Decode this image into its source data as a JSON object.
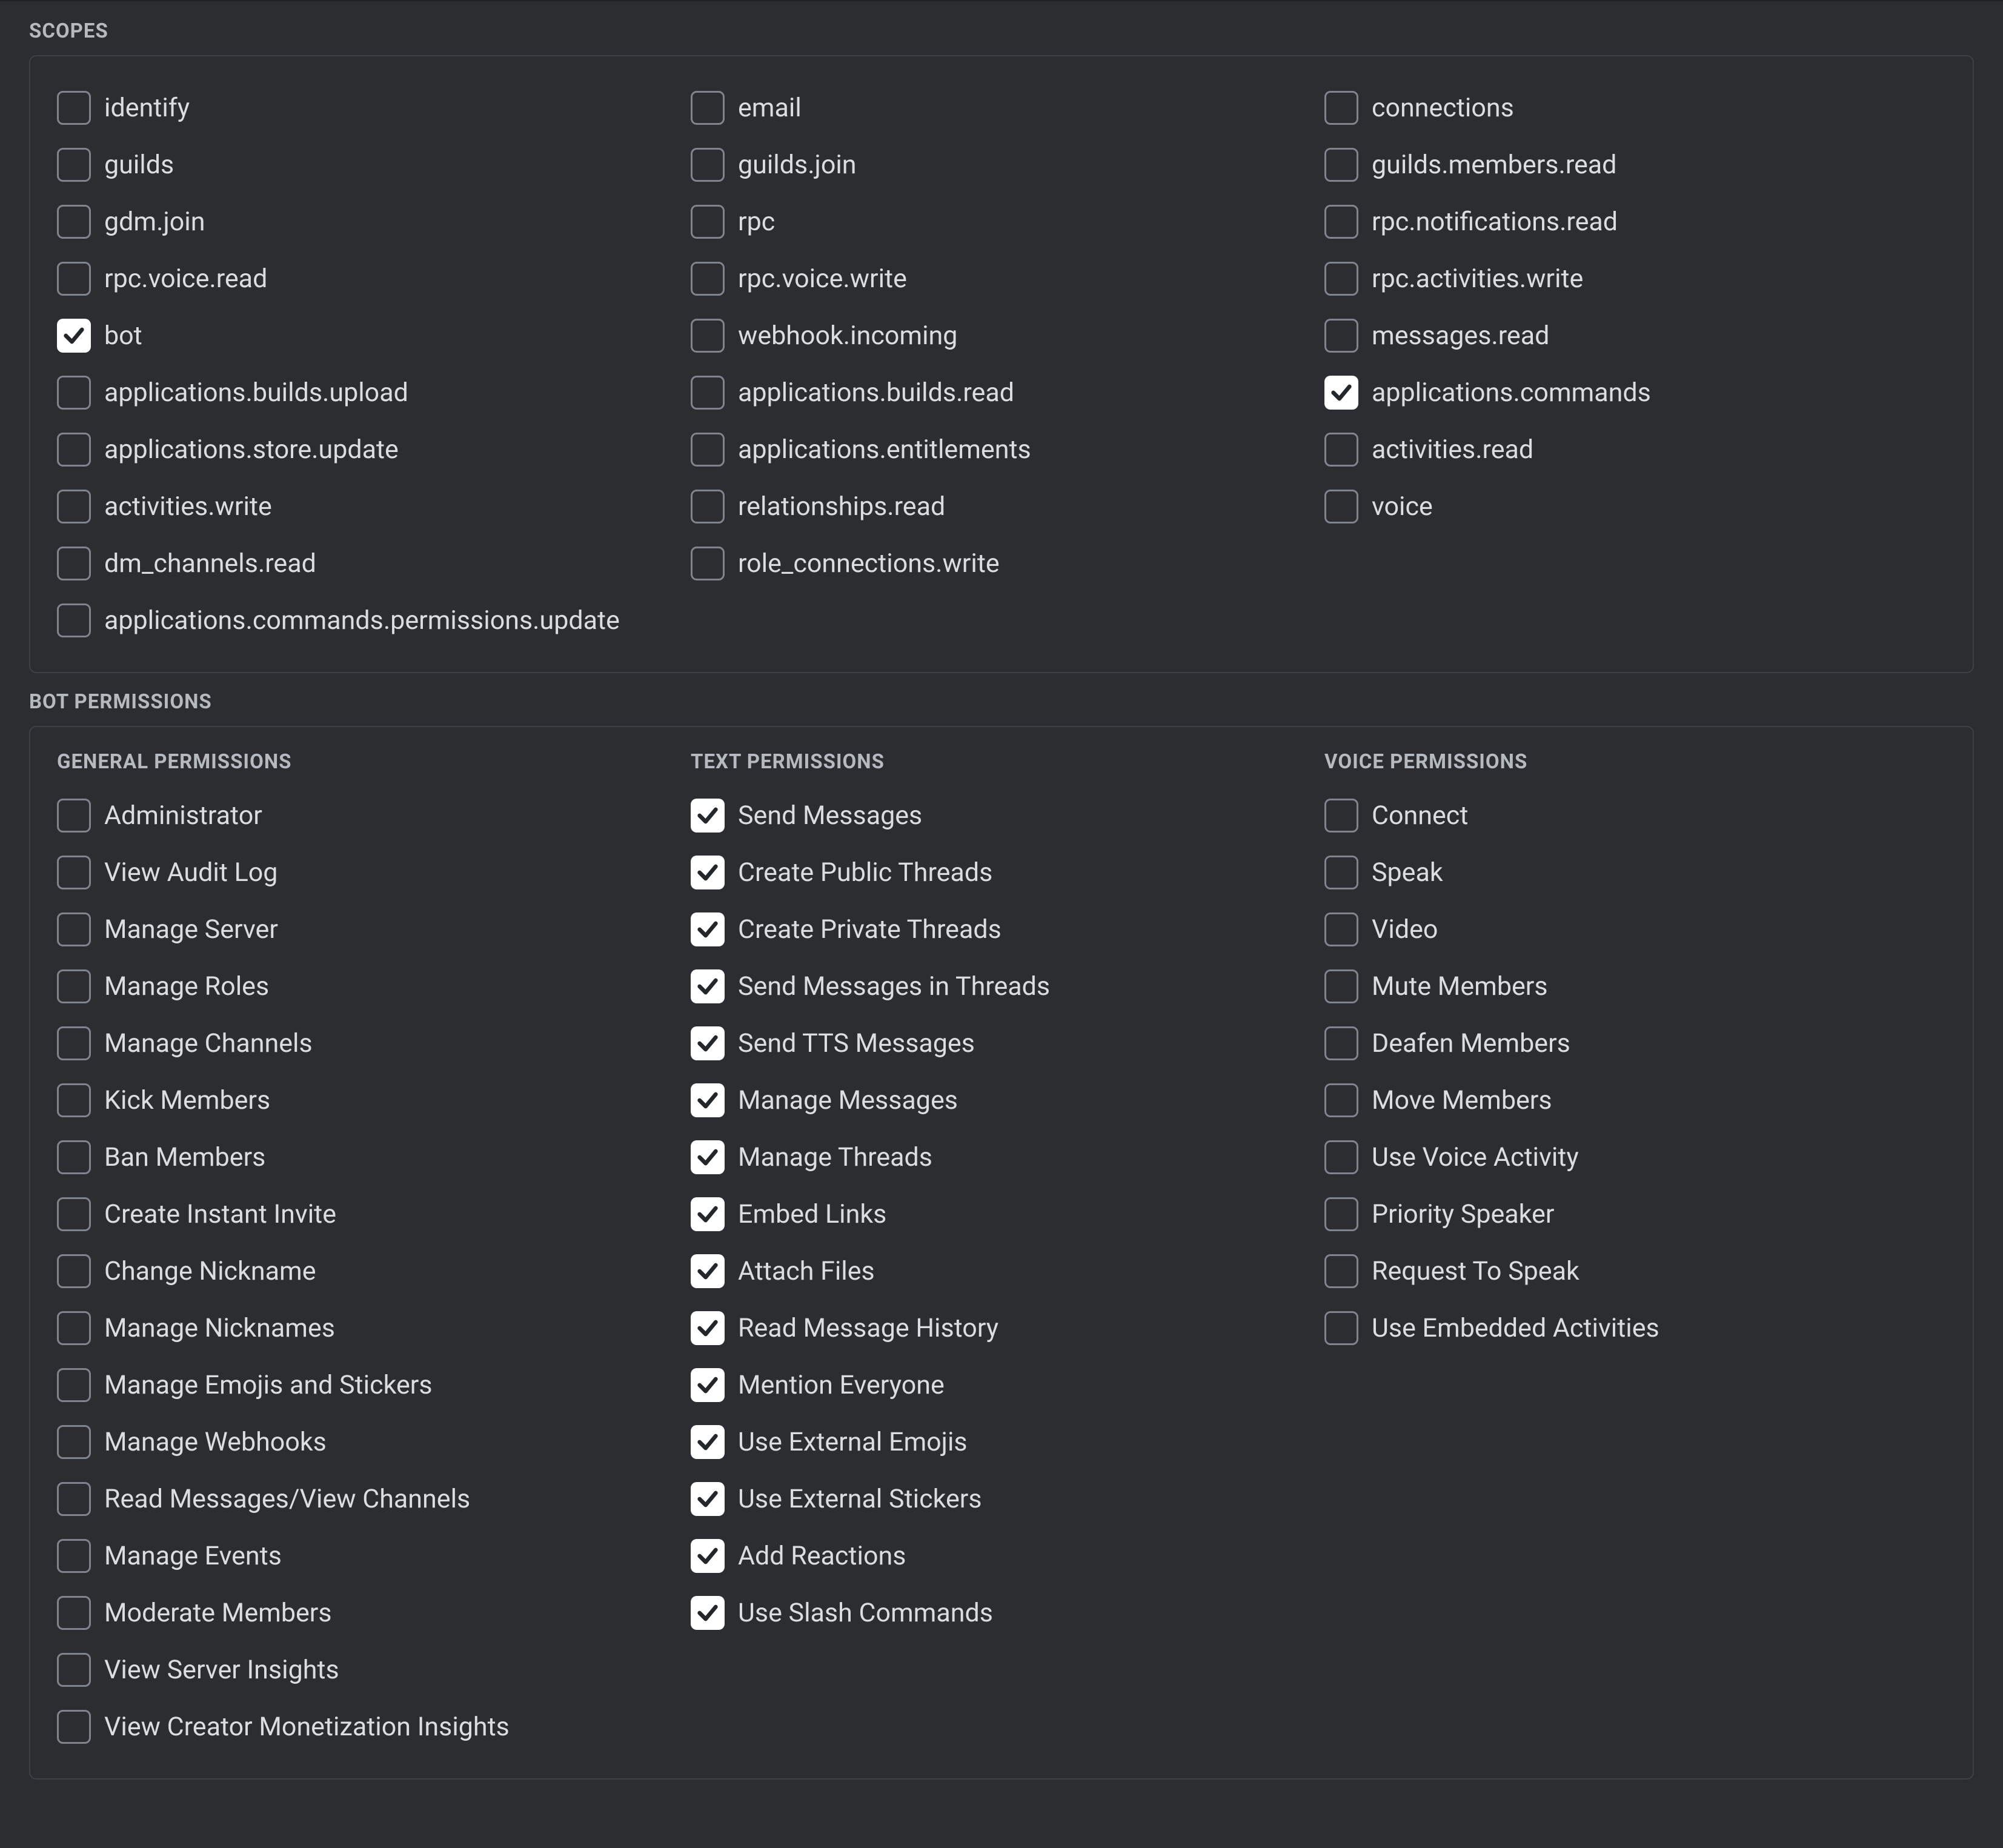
{
  "scopes": {
    "title": "SCOPES",
    "cols": [
      [
        {
          "label": "identify",
          "checked": false
        },
        {
          "label": "guilds",
          "checked": false
        },
        {
          "label": "gdm.join",
          "checked": false
        },
        {
          "label": "rpc.voice.read",
          "checked": false
        },
        {
          "label": "bot",
          "checked": true
        },
        {
          "label": "applications.builds.upload",
          "checked": false
        },
        {
          "label": "applications.store.update",
          "checked": false
        },
        {
          "label": "activities.write",
          "checked": false
        },
        {
          "label": "dm_channels.read",
          "checked": false
        },
        {
          "label": "applications.commands.permissions.update",
          "checked": false
        }
      ],
      [
        {
          "label": "email",
          "checked": false
        },
        {
          "label": "guilds.join",
          "checked": false
        },
        {
          "label": "rpc",
          "checked": false
        },
        {
          "label": "rpc.voice.write",
          "checked": false
        },
        {
          "label": "webhook.incoming",
          "checked": false
        },
        {
          "label": "applications.builds.read",
          "checked": false
        },
        {
          "label": "applications.entitlements",
          "checked": false
        },
        {
          "label": "relationships.read",
          "checked": false
        },
        {
          "label": "role_connections.write",
          "checked": false
        }
      ],
      [
        {
          "label": "connections",
          "checked": false
        },
        {
          "label": "guilds.members.read",
          "checked": false
        },
        {
          "label": "rpc.notifications.read",
          "checked": false
        },
        {
          "label": "rpc.activities.write",
          "checked": false
        },
        {
          "label": "messages.read",
          "checked": false
        },
        {
          "label": "applications.commands",
          "checked": true
        },
        {
          "label": "activities.read",
          "checked": false
        },
        {
          "label": "voice",
          "checked": false
        }
      ]
    ]
  },
  "permissions": {
    "title": "BOT PERMISSIONS",
    "cols": [
      {
        "heading": "GENERAL PERMISSIONS",
        "items": [
          {
            "label": "Administrator",
            "checked": false
          },
          {
            "label": "View Audit Log",
            "checked": false
          },
          {
            "label": "Manage Server",
            "checked": false
          },
          {
            "label": "Manage Roles",
            "checked": false
          },
          {
            "label": "Manage Channels",
            "checked": false
          },
          {
            "label": "Kick Members",
            "checked": false
          },
          {
            "label": "Ban Members",
            "checked": false
          },
          {
            "label": "Create Instant Invite",
            "checked": false
          },
          {
            "label": "Change Nickname",
            "checked": false
          },
          {
            "label": "Manage Nicknames",
            "checked": false
          },
          {
            "label": "Manage Emojis and Stickers",
            "checked": false
          },
          {
            "label": "Manage Webhooks",
            "checked": false
          },
          {
            "label": "Read Messages/View Channels",
            "checked": false
          },
          {
            "label": "Manage Events",
            "checked": false
          },
          {
            "label": "Moderate Members",
            "checked": false
          },
          {
            "label": "View Server Insights",
            "checked": false
          },
          {
            "label": "View Creator Monetization Insights",
            "checked": false
          }
        ]
      },
      {
        "heading": "TEXT PERMISSIONS",
        "items": [
          {
            "label": "Send Messages",
            "checked": true
          },
          {
            "label": "Create Public Threads",
            "checked": true
          },
          {
            "label": "Create Private Threads",
            "checked": true
          },
          {
            "label": "Send Messages in Threads",
            "checked": true
          },
          {
            "label": "Send TTS Messages",
            "checked": true
          },
          {
            "label": "Manage Messages",
            "checked": true
          },
          {
            "label": "Manage Threads",
            "checked": true
          },
          {
            "label": "Embed Links",
            "checked": true
          },
          {
            "label": "Attach Files",
            "checked": true
          },
          {
            "label": "Read Message History",
            "checked": true
          },
          {
            "label": "Mention Everyone",
            "checked": true
          },
          {
            "label": "Use External Emojis",
            "checked": true
          },
          {
            "label": "Use External Stickers",
            "checked": true
          },
          {
            "label": "Add Reactions",
            "checked": true
          },
          {
            "label": "Use Slash Commands",
            "checked": true
          }
        ]
      },
      {
        "heading": "VOICE PERMISSIONS",
        "items": [
          {
            "label": "Connect",
            "checked": false
          },
          {
            "label": "Speak",
            "checked": false
          },
          {
            "label": "Video",
            "checked": false
          },
          {
            "label": "Mute Members",
            "checked": false
          },
          {
            "label": "Deafen Members",
            "checked": false
          },
          {
            "label": "Move Members",
            "checked": false
          },
          {
            "label": "Use Voice Activity",
            "checked": false
          },
          {
            "label": "Priority Speaker",
            "checked": false
          },
          {
            "label": "Request To Speak",
            "checked": false
          },
          {
            "label": "Use Embedded Activities",
            "checked": false
          }
        ]
      }
    ]
  }
}
